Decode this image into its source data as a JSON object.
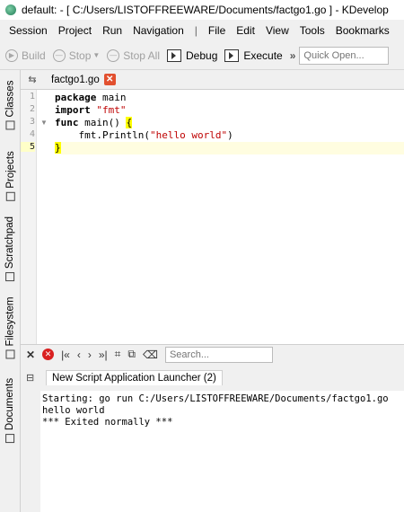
{
  "window": {
    "title": "default:  - [ C:/Users/LISTOFFREEWARE/Documents/factgo1.go ] - KDevelop",
    "icon": "kdevelop-app-icon"
  },
  "menubar": {
    "items": [
      "Session",
      "Project",
      "Run",
      "Navigation",
      "File",
      "Edit",
      "View",
      "Tools",
      "Bookmarks"
    ],
    "separator": "|"
  },
  "toolbar": {
    "build_label": "Build",
    "stop_label": "Stop",
    "stopall_label": "Stop All",
    "debug_label": "Debug",
    "execute_label": "Execute",
    "overflow": "»",
    "quick_open_placeholder": "Quick Open..."
  },
  "left_dock": {
    "tabs": [
      "Classes",
      "Projects",
      "Scratchpad",
      "Filesystem",
      "Documents"
    ]
  },
  "editor": {
    "tab_label": "factgo1.go",
    "line_numbers": [
      "1",
      "2",
      "3",
      "4",
      "5"
    ],
    "current_line": 5,
    "lines": [
      {
        "kw": "package",
        "rest": " main"
      },
      {
        "kw": "import",
        "str": " \"fmt\""
      },
      {
        "kw": "func",
        "rest": " main() ",
        "brace": "{"
      },
      {
        "pre": "    fmt.Println(",
        "str": "\"hello world\"",
        "post": ")"
      },
      {
        "brace": "}"
      }
    ]
  },
  "bottom_panel": {
    "tab_label": "New Script Application Launcher (2)",
    "search_placeholder": "Search...",
    "output": [
      "Starting: go run C:/Users/LISTOFFREEWARE/Documents/factgo1.go",
      "hello world",
      "*** Exited normally ***"
    ]
  },
  "colors": {
    "close_badge": "#e2502f",
    "stop_button": "#d92020",
    "string": "#bf0303",
    "brace_highlight": "#ffff00"
  }
}
